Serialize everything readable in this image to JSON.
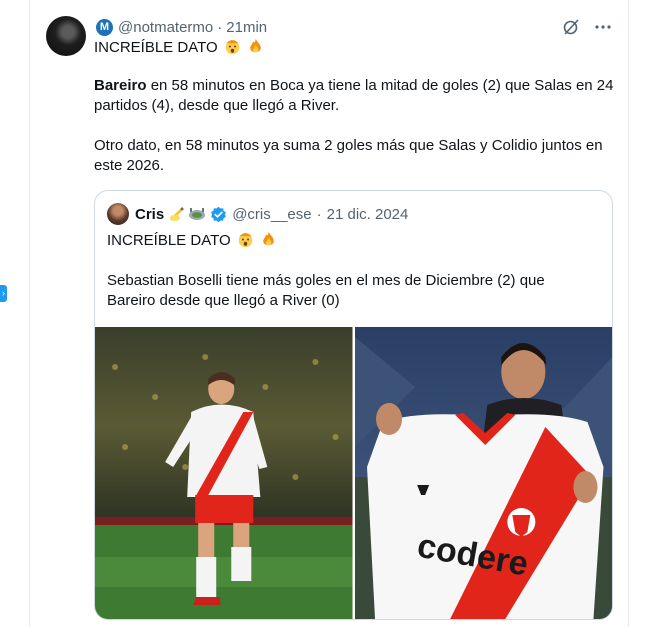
{
  "tweet": {
    "handle": "@notmatermo",
    "separator": "·",
    "time": "21min",
    "headline": "INCREÍBLE DATO",
    "para2_bold": "Bareiro",
    "para2_rest": " en 58 minutos en Boca ya tiene la mitad de goles (2) que Salas en 24 partidos (4), desde que llegó a River.",
    "para3": "Otro dato, en 58 minutos ya suma 2 goles más que Salas y Colidio juntos en este 2026."
  },
  "quote": {
    "name": "Cris",
    "handle": "@cris__ese",
    "separator": "·",
    "date": "21 dic. 2024",
    "headline": "INCREÍBLE DATO",
    "body": "Sebastian Boselli tiene más goles en el mes de Diciembre (2) que Bareiro desde que llegó a River (0)",
    "image2_brand": "codere"
  },
  "colors": {
    "accent": "#1d9bf0",
    "river_red": "#e1251b",
    "text_secondary": "#536471"
  }
}
